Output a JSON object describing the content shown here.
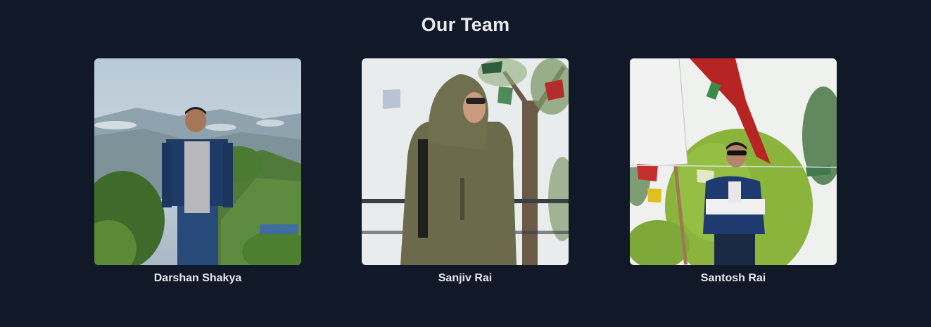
{
  "section": {
    "title": "Our Team"
  },
  "colors": {
    "background": "#111827",
    "text": "#e5e7eb"
  },
  "team": [
    {
      "name": "Darshan Shakya",
      "photo": "person-on-mountain-viewpoint"
    },
    {
      "name": "Sanjiv Rai",
      "photo": "person-in-green-hooded-jacket"
    },
    {
      "name": "Santosh Rai",
      "photo": "person-with-prayer-flags"
    }
  ]
}
